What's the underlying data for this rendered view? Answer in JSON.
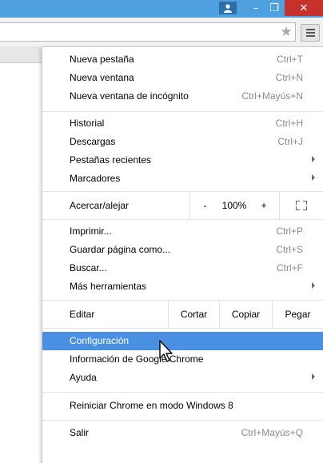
{
  "window": {
    "user_icon": "user-icon",
    "minimize_glyph": "–",
    "maximize_glyph": "❐",
    "close_glyph": "✕"
  },
  "toolbar": {
    "bookmark_icon": "star-icon",
    "menu_icon": "hamburger-menu-icon"
  },
  "menu": {
    "group1": [
      {
        "label": "Nueva pestaña",
        "shortcut": "Ctrl+T"
      },
      {
        "label": "Nueva ventana",
        "shortcut": "Ctrl+N"
      },
      {
        "label": "Nueva ventana de incógnito",
        "shortcut": "Ctrl+Mayús+N"
      }
    ],
    "group2": [
      {
        "label": "Historial",
        "shortcut": "Ctrl+H"
      },
      {
        "label": "Descargas",
        "shortcut": "Ctrl+J"
      },
      {
        "label": "Pestañas recientes",
        "shortcut": ""
      },
      {
        "label": "Marcadores",
        "shortcut": ""
      }
    ],
    "zoom": {
      "label": "Acercar/alejar",
      "minus": "-",
      "level": "100%",
      "plus": "+"
    },
    "group3": [
      {
        "label": "Imprimir...",
        "shortcut": "Ctrl+P"
      },
      {
        "label": "Guardar página como...",
        "shortcut": "Ctrl+S"
      },
      {
        "label": "Buscar...",
        "shortcut": "Ctrl+F"
      },
      {
        "label": "Más herramientas",
        "shortcut": ""
      }
    ],
    "edit": {
      "label": "Editar",
      "cut": "Cortar",
      "copy": "Copiar",
      "paste": "Pegar"
    },
    "group4": [
      {
        "label": "Configuración",
        "shortcut": ""
      },
      {
        "label": "Información de Google Chrome",
        "shortcut": ""
      },
      {
        "label": "Ayuda",
        "shortcut": ""
      }
    ],
    "group5": [
      {
        "label": "Reiniciar Chrome en modo Windows 8",
        "shortcut": ""
      }
    ],
    "group6": [
      {
        "label": "Salir",
        "shortcut": "Ctrl+Mayús+Q"
      }
    ]
  },
  "colors": {
    "titlebar": "#4ea1de",
    "close_button": "#c7312b",
    "highlight": "#4a90e2"
  }
}
